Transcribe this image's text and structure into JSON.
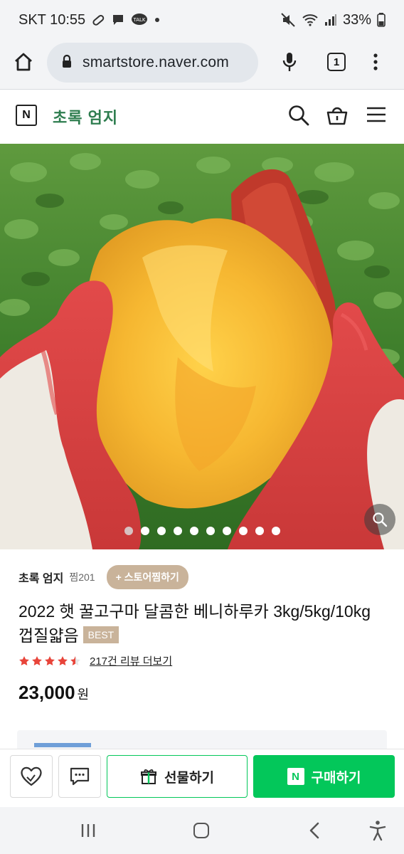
{
  "status_bar": {
    "carrier_time": "SKT 10:55",
    "talk_badge": "TALK",
    "battery": "33%"
  },
  "browser": {
    "url": "smartstore.naver.com",
    "tab_count": "1"
  },
  "store_header": {
    "logo_letter": "N",
    "store_name": "초록 엄지"
  },
  "gallery": {
    "image_subject": "baked sweet potato held in red work gloves over sweet potato field",
    "dot_count": 10,
    "active_index": 0
  },
  "product": {
    "seller_name": "초록 엄지",
    "zzim": "찜201",
    "follow_label": "+ 스토어찜하기",
    "title": "2022 햇 꿀고구마 달콤한 베니하루카 3kg/5kg/10kg 껍질얇음",
    "badge": "BEST",
    "rating": 4.5,
    "review_link": "217건 리뷰 더보기",
    "price": "23,000",
    "currency": "원"
  },
  "actions": {
    "gift_label": "선물하기",
    "buy_label": "구매하기",
    "buy_logo": "N"
  },
  "colors": {
    "naver_green": "#03c75a",
    "store_green": "#2e7d4f",
    "tag_tan": "#c9b39a",
    "star_red": "#e8443a"
  }
}
